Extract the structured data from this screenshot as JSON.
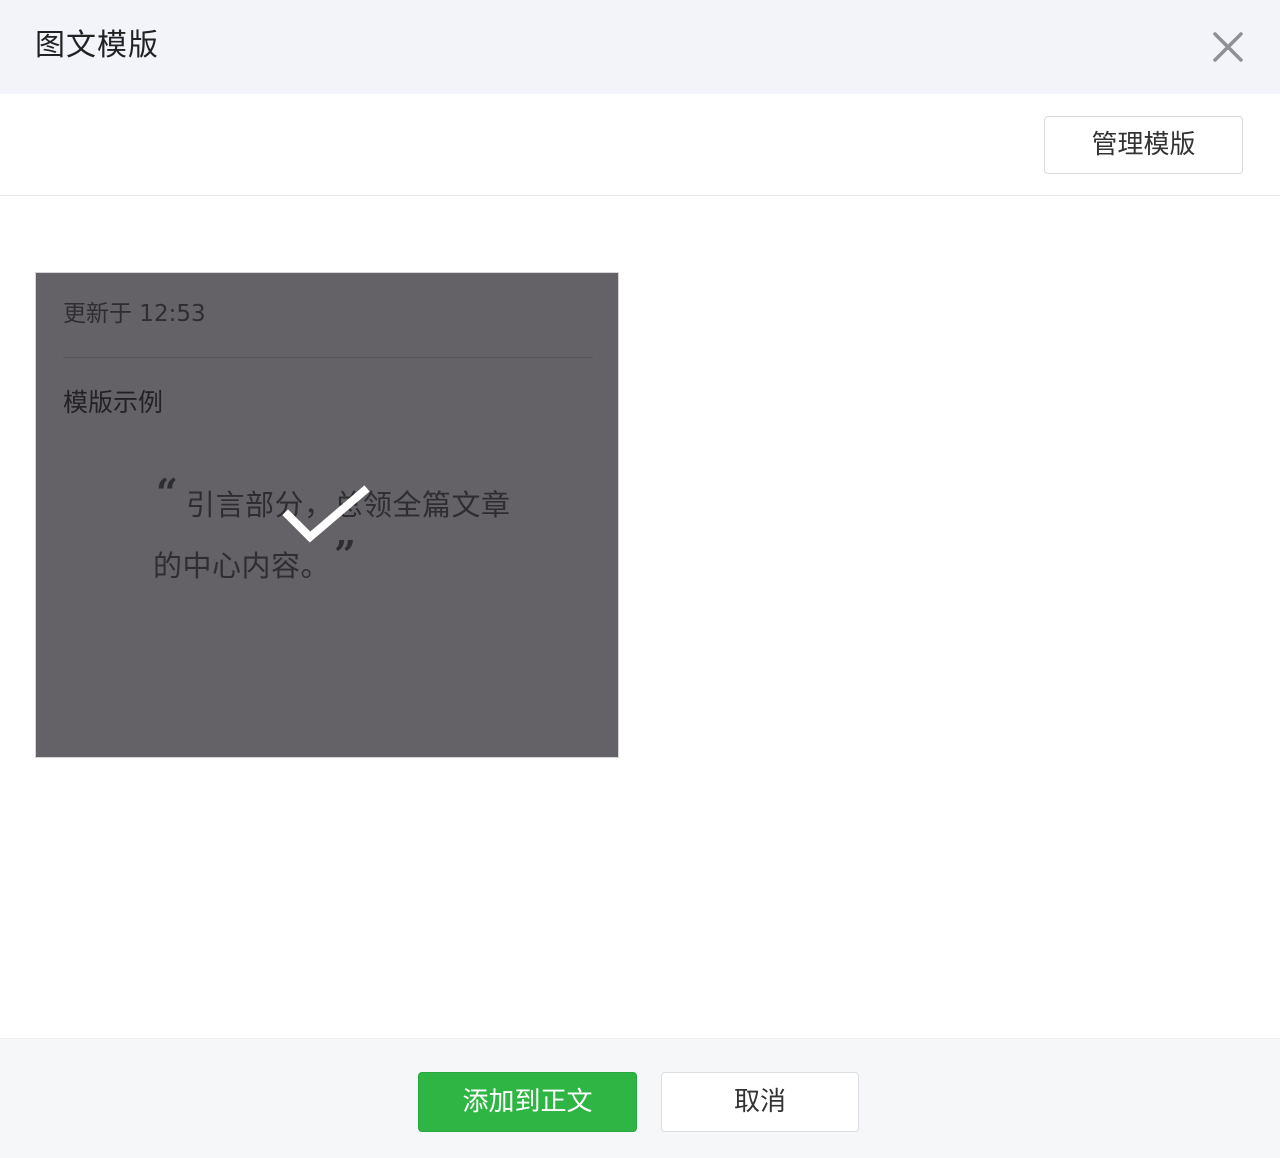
{
  "dialog": {
    "title": "图文模版",
    "close_icon": "close-icon"
  },
  "toolbar": {
    "manage_label": "管理模版"
  },
  "template_card": {
    "updated_text": "更新于 12:53",
    "title": "模版示例",
    "quote_open": "“",
    "quote_line1": "引言部分，总领全篇文章",
    "quote_line2": "的中心内容。",
    "quote_close": "”",
    "selected": true,
    "selected_icon": "checkmark-icon"
  },
  "footer": {
    "primary_label": "添加到正文",
    "secondary_label": "取消"
  },
  "colors": {
    "header_bg": "#f3f4fa",
    "card_overlay": "#646266",
    "primary": "#2fb544"
  }
}
